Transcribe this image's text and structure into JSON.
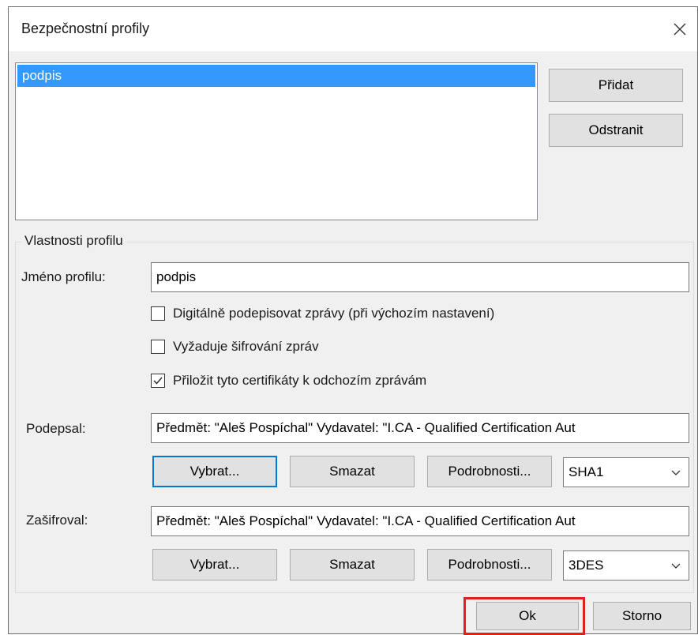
{
  "window": {
    "title": "Bezpečnostní profily"
  },
  "profiles_list": {
    "items": [
      "podpis"
    ],
    "selected_index": 0
  },
  "side_buttons": {
    "add_label": "Přidat",
    "remove_label": "Odstranit"
  },
  "profile_properties": {
    "group_label": "Vlastnosti profilu",
    "name_label": "Jméno profilu:",
    "name_value": "podpis",
    "checkboxes": [
      {
        "label": "Digitálně podepisovat zprávy (při výchozím nastavení)",
        "checked": false
      },
      {
        "label": "Vyžaduje šifrování zpráv",
        "checked": false
      },
      {
        "label": "Přiložit tyto certifikáty k odchozím zprávám",
        "checked": true
      }
    ],
    "signing": {
      "label": "Podepsal:",
      "certificate": "Předmět: \"Aleš Pospíchal\" Vydavatel: \"I.CA - Qualified Certification Aut",
      "select_label": "Vybrat...",
      "clear_label": "Smazat",
      "details_label": "Podrobnosti...",
      "algorithm": "SHA1"
    },
    "encryption": {
      "label": "Zašifroval:",
      "certificate": "Předmět: \"Aleš Pospíchal\" Vydavatel: \"I.CA - Qualified Certification Aut",
      "select_label": "Vybrat...",
      "clear_label": "Smazat",
      "details_label": "Podrobnosti...",
      "algorithm": "3DES"
    }
  },
  "footer": {
    "ok_label": "Ok",
    "cancel_label": "Storno"
  },
  "colors": {
    "selection": "#3399ff",
    "focus_border": "#0078d7",
    "highlight_box": "#e02020"
  }
}
